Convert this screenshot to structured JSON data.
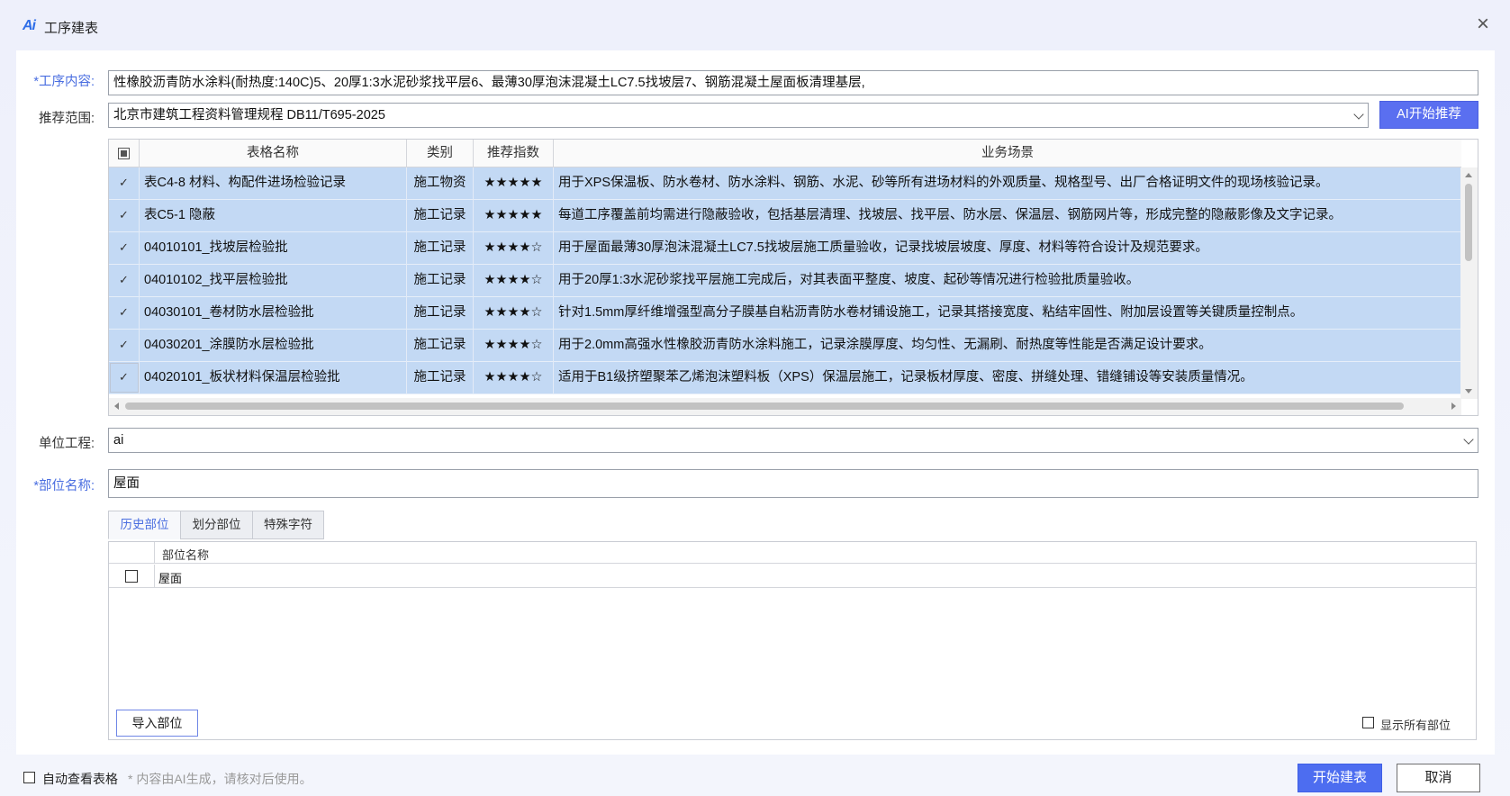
{
  "window": {
    "logo_text": "Ai",
    "title": "工序建表",
    "close_glyph": "×"
  },
  "form": {
    "process_label": "*工序内容:",
    "process_value": "性橡胶沥青防水涂料(耐热度:140C)5、20厚1:3水泥砂浆找平层6、最薄30厚泡沫混凝土LC7.5找坡层7、钢筋混凝土屋面板清理基层,",
    "scope_label": "推荐范围:",
    "scope_value": "北京市建筑工程资料管理规程 DB11/T695-2025",
    "ai_button": "AI开始推荐",
    "unit_label": "单位工程:",
    "unit_value": "ai",
    "part_label": "*部位名称:",
    "part_value": "屋面"
  },
  "table": {
    "headers": {
      "name": "表格名称",
      "category": "类别",
      "score": "推荐指数",
      "scene": "业务场景"
    },
    "rows": [
      {
        "check": "✓",
        "name": "表C4-8 材料、构配件进场检验记录",
        "category": "施工物资",
        "score": "★★★★★",
        "scene": "用于XPS保温板、防水卷材、防水涂料、钢筋、水泥、砂等所有进场材料的外观质量、规格型号、出厂合格证明文件的现场核验记录。"
      },
      {
        "check": "✓",
        "name": "表C5-1 隐蔽",
        "category": "施工记录",
        "score": "★★★★★",
        "scene": "每道工序覆盖前均需进行隐蔽验收，包括基层清理、找坡层、找平层、防水层、保温层、钢筋网片等，形成完整的隐蔽影像及文字记录。"
      },
      {
        "check": "✓",
        "name": "04010101_找坡层检验批",
        "category": "施工记录",
        "score": "★★★★☆",
        "scene": "用于屋面最薄30厚泡沫混凝土LC7.5找坡层施工质量验收，记录找坡层坡度、厚度、材料等符合设计及规范要求。"
      },
      {
        "check": "✓",
        "name": "04010102_找平层检验批",
        "category": "施工记录",
        "score": "★★★★☆",
        "scene": "用于20厚1:3水泥砂浆找平层施工完成后，对其表面平整度、坡度、起砂等情况进行检验批质量验收。"
      },
      {
        "check": "✓",
        "name": "04030101_卷材防水层检验批",
        "category": "施工记录",
        "score": "★★★★☆",
        "scene": "针对1.5mm厚纤维增强型高分子膜基自粘沥青防水卷材铺设施工，记录其搭接宽度、粘结牢固性、附加层设置等关键质量控制点。"
      },
      {
        "check": "✓",
        "name": "04030201_涂膜防水层检验批",
        "category": "施工记录",
        "score": "★★★★☆",
        "scene": "用于2.0mm高强水性橡胶沥青防水涂料施工，记录涂膜厚度、均匀性、无漏刷、耐热度等性能是否满足设计要求。"
      },
      {
        "check": "✓",
        "name": "04020101_板状材料保温层检验批",
        "category": "施工记录",
        "score": "★★★★☆",
        "scene": "适用于B1级挤塑聚苯乙烯泡沫塑料板（XPS）保温层施工，记录板材厚度、密度、拼缝处理、错缝铺设等安装质量情况。"
      }
    ]
  },
  "tabs": [
    {
      "label": "历史部位"
    },
    {
      "label": "划分部位"
    },
    {
      "label": "特殊字符"
    }
  ],
  "part_list": {
    "header": "部位名称",
    "rows": [
      {
        "name": "屋面"
      }
    ],
    "import_button": "导入部位",
    "show_all_label": "显示所有部位"
  },
  "footer": {
    "auto_view_label": "自动查看表格",
    "note": "* 内容由AI生成，请核对后使用。",
    "start_button": "开始建表",
    "cancel_button": "取消"
  },
  "colors": {
    "accent": "#4d6df0",
    "selected_row": "#c3d9f4",
    "required_label": "#4a6ee0"
  }
}
